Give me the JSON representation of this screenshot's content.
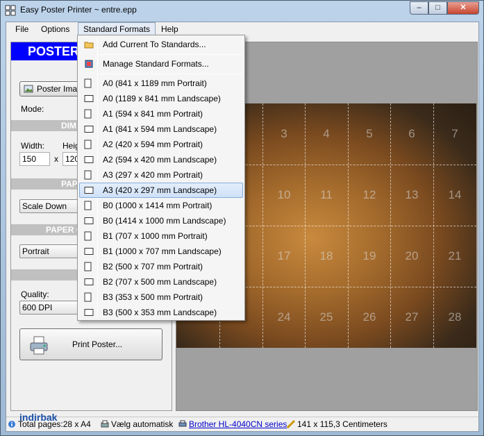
{
  "window": {
    "title": "Easy Poster Printer ~ entre.epp",
    "minimize": "–",
    "maximize": "□",
    "close": "✕"
  },
  "menubar": {
    "items": [
      "File",
      "Options",
      "Standard Formats",
      "Help"
    ]
  },
  "left_panel": {
    "header": "POSTER",
    "poster_image_button": "Poster Image",
    "mode_label": "Mode:",
    "section_dimensions": "DIM",
    "width_label": "Width:",
    "height_label": "Heig",
    "width_value": "150",
    "times": "x",
    "height_value": "120",
    "section_paper": "PAPE",
    "scale_combo": "Scale Down",
    "section_paper_orientation": "PAPER O",
    "orientation_combo": "Portrait",
    "quality_label": "Quality:",
    "quality_combo": "600 DPI",
    "print_button": "Print Poster..."
  },
  "preview": {
    "page_numbers": [
      "3",
      "4",
      "5",
      "6",
      "7",
      "10",
      "11",
      "12",
      "13",
      "14",
      "17",
      "18",
      "19",
      "20",
      "21",
      "24",
      "25",
      "26",
      "27",
      "28"
    ]
  },
  "dropdown": {
    "add_current": "Add Current To Standards...",
    "manage": "Manage Standard Formats...",
    "formats": [
      "A0 (841 x 1189 mm Portrait)",
      "A0 (1189 x 841 mm Landscape)",
      "A1 (594 x 841 mm Portrait)",
      "A1 (841 x 594 mm Landscape)",
      "A2 (420 x 594 mm Portrait)",
      "A2 (594 x 420 mm Landscape)",
      "A3 (297 x 420 mm Portrait)",
      "A3 (420 x 297 mm Landscape)",
      "B0 (1000 x 1414 mm Portrait)",
      "B0 (1414 x 1000 mm Landscape)",
      "B1 (707 x 1000 mm Portrait)",
      "B1 (1000 x 707 mm Landscape)",
      "B2 (500 x 707 mm Portrait)",
      "B2 (707 x 500 mm Landscape)",
      "B3 (353 x 500 mm Portrait)",
      "B3 (500 x 353 mm Landscape)"
    ],
    "selected_label": "A3 (420 x 297 mm Landscape)"
  },
  "statusbar": {
    "total_pages": "Total pages:28 x A4",
    "paper_source": "Vælg automatisk",
    "printer": "Brother HL-4040CN series",
    "size": "141 x 115,3 Centimeters"
  },
  "watermark": "indirbak",
  "colors": {
    "header_blue": "#0000ff",
    "selection": "#cfe1f8",
    "link": "#0000cc"
  }
}
